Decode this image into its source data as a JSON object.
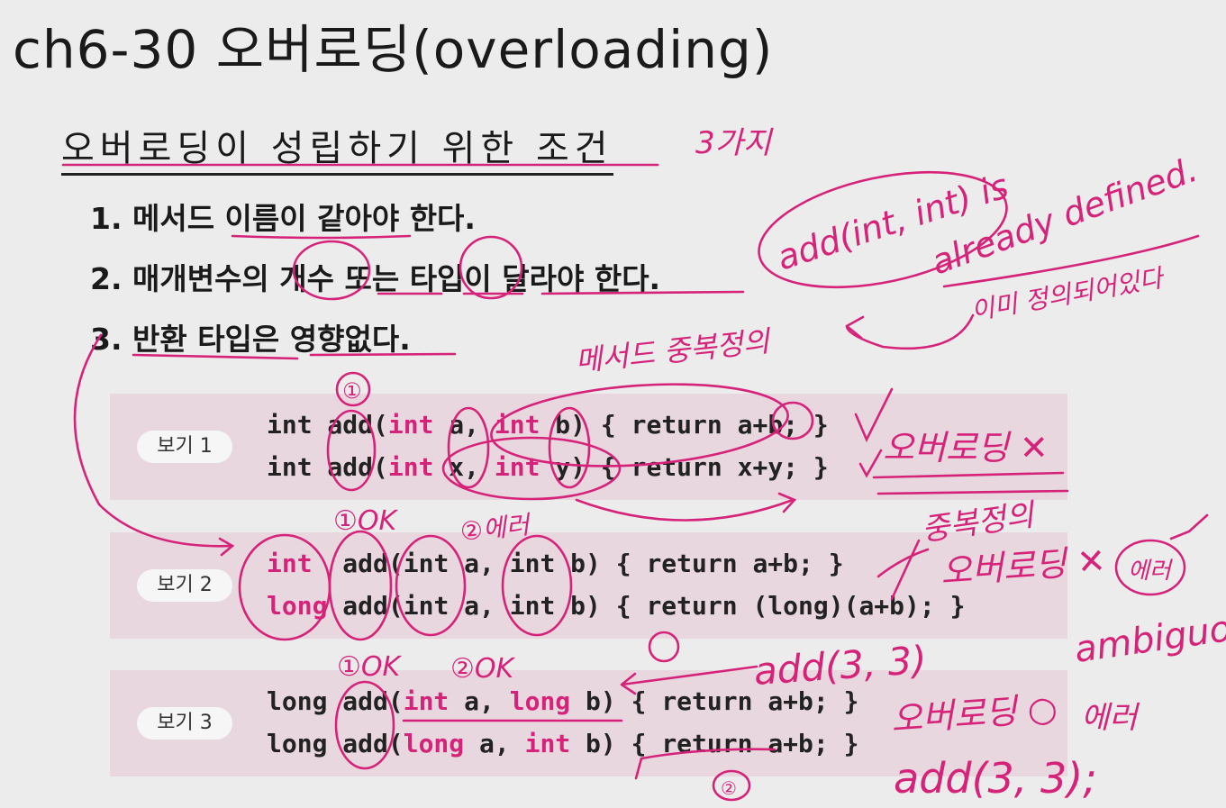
{
  "title": "ch6-30 오버로딩(overloading)",
  "subtitle": "오버로딩이 성립하기 위한 조건",
  "conditions": [
    "1. 메서드 이름이 같아야 한다.",
    "2. 매개변수의 개수 또는 타입이 달라야 한다.",
    "3. 반환 타입은 영향없다."
  ],
  "examples": [
    {
      "badge": "보기 1",
      "lines": [
        [
          {
            "t": "int add("
          },
          {
            "t": "int",
            "hl": true
          },
          {
            "t": " a, "
          },
          {
            "t": "int",
            "hl": true
          },
          {
            "t": " b) { return a+b; }"
          }
        ],
        [
          {
            "t": "int add("
          },
          {
            "t": "int",
            "hl": true
          },
          {
            "t": " x, "
          },
          {
            "t": "int",
            "hl": true
          },
          {
            "t": " y) { return x+y; }"
          }
        ]
      ]
    },
    {
      "badge": "보기 2",
      "lines": [
        [
          {
            "t": "int",
            "hl": true
          },
          {
            "t": "  add(int a, int b) { return a+b; }"
          }
        ],
        [
          {
            "t": "long",
            "hl": true
          },
          {
            "t": " add(int a, int b) { return (long)(a+b); }"
          }
        ]
      ]
    },
    {
      "badge": "보기 3",
      "lines": [
        [
          {
            "t": "long add("
          },
          {
            "t": "int",
            "hl": true
          },
          {
            "t": " a, "
          },
          {
            "t": "long",
            "hl": true
          },
          {
            "t": " b) { return a+b; }"
          }
        ],
        [
          {
            "t": "long add("
          },
          {
            "t": "long",
            "hl": true
          },
          {
            "t": " a, "
          },
          {
            "t": "int",
            "hl": true
          },
          {
            "t": " b) { return a+b; }"
          }
        ]
      ]
    }
  ],
  "annotations": {
    "three_kinds": "3가지",
    "already_defined_sig": "add(int, int) is",
    "already_defined": "already defined.",
    "already_defined_ko": "이미 정의되어있다",
    "method_redefinition": "메서드 중복정의",
    "circle_1": "①",
    "not_overloading": "오버로딩 ✕",
    "ok_1": "①OK",
    "error_2": "②에러",
    "redefinition": "중복정의",
    "not_overloading_2": "오버로딩 ✕",
    "error_box": "에러",
    "ambiguous": "ambiguous",
    "ok_1b": "①OK",
    "ok_2b": "②OK",
    "call_add_3_3_top": "add(3, 3)",
    "overloading_ok": "오버로딩 ○",
    "error_3": "에러",
    "call_add_3_3": "add(3, 3);",
    "circle_2": "②"
  },
  "colors": {
    "ink": "#d6237a",
    "example_bg": "#e8d7de",
    "badge_bg": "#f6f6f6"
  }
}
